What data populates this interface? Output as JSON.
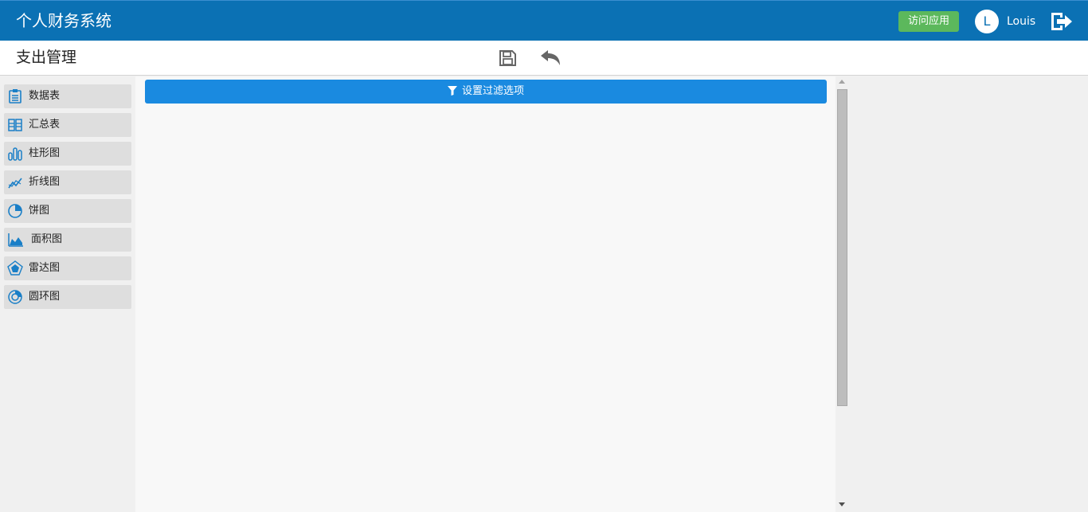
{
  "header": {
    "app_title": "个人财务系统",
    "visit_app_label": "访问应用",
    "avatar_letter": "L",
    "username": "Louis",
    "accent_color": "#0b71b4",
    "visit_color": "#5cb85c"
  },
  "subheader": {
    "page_title": "支出管理",
    "icons": [
      "save-icon",
      "undo-icon"
    ]
  },
  "sidebar": {
    "items": [
      {
        "label": "数据表",
        "icon": "data-table-icon"
      },
      {
        "label": "汇总表",
        "icon": "summary-table-icon"
      },
      {
        "label": "柱形图",
        "icon": "bar-chart-icon"
      },
      {
        "label": "折线图",
        "icon": "line-chart-icon"
      },
      {
        "label": "饼图",
        "icon": "pie-chart-icon"
      },
      {
        "label": "面积图",
        "icon": "area-chart-icon"
      },
      {
        "label": "雷达图",
        "icon": "radar-chart-icon"
      },
      {
        "label": "圆环图",
        "icon": "donut-chart-icon"
      }
    ]
  },
  "main": {
    "filter_button_label": "设置过滤选项",
    "filter_color": "#1a8ae0"
  }
}
